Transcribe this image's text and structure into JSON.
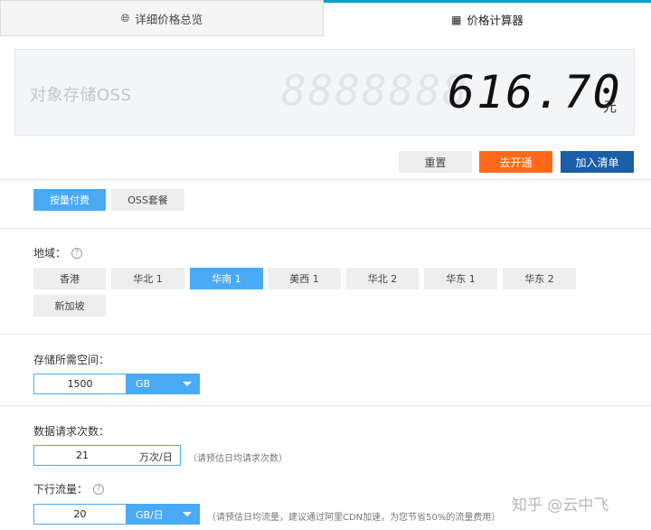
{
  "tabs": [
    {
      "label": "详细价格总览",
      "icon": "globe-icon"
    },
    {
      "label": "价格计算器",
      "icon": "calculator-icon"
    }
  ],
  "price": {
    "product": "对象存储OSS",
    "digits_placeholder": "8888888",
    "value": "616.70",
    "unit": "元"
  },
  "actions": {
    "reset": "重置",
    "open": "去开通",
    "add": "加入清单"
  },
  "billing": [
    {
      "label": "按量付费",
      "active": true
    },
    {
      "label": "OSS套餐",
      "active": false
    }
  ],
  "region": {
    "label": "地域：",
    "options": [
      {
        "label": "香港",
        "active": false
      },
      {
        "label": "华北 1",
        "active": false
      },
      {
        "label": "华南 1",
        "active": true
      },
      {
        "label": "美西 1",
        "active": false
      },
      {
        "label": "华北 2",
        "active": false
      },
      {
        "label": "华东 1",
        "active": false
      },
      {
        "label": "华东 2",
        "active": false
      },
      {
        "label": "新加坡",
        "active": false
      }
    ]
  },
  "storage": {
    "label": "存储所需空间：",
    "value": "1500",
    "unit": "GB"
  },
  "requests": {
    "label": "数据请求次数：",
    "value": "21",
    "unit": "万次/日",
    "hint": "（请预估日均请求次数）"
  },
  "traffic": {
    "label": "下行流量：",
    "value": "20",
    "unit": "GB/日",
    "hint": "（请预估日均流量，建议通过阿里CDN加速，为您节省50%的流量费用）"
  },
  "watermark": "知乎 @云中飞",
  "colors": {
    "accent": "#4aaaf5",
    "orange": "#ff6a1a",
    "navy": "#1a5ea6",
    "tab_top": "#00a2ca"
  }
}
